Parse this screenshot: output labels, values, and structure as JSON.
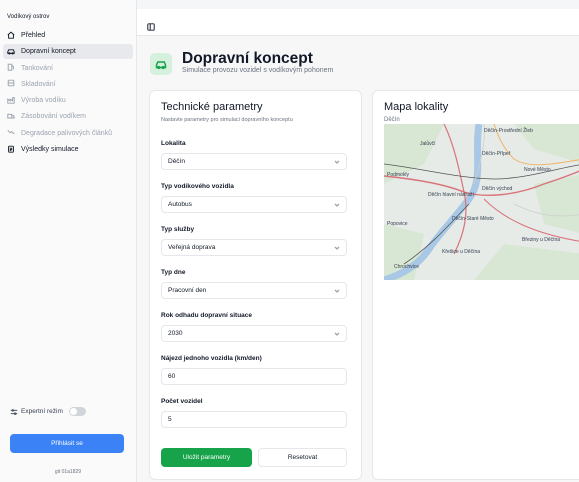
{
  "sidebar": {
    "title": "Vodíkový ostrov",
    "items": [
      {
        "label": "Přehled",
        "icon": "home-icon",
        "state": "normal"
      },
      {
        "label": "Dopravní koncept",
        "icon": "car-icon",
        "state": "active"
      },
      {
        "label": "Tankování",
        "icon": "fuel-pump-icon",
        "state": "disabled"
      },
      {
        "label": "Skladování",
        "icon": "database-icon",
        "state": "disabled"
      },
      {
        "label": "Výroba vodíku",
        "icon": "factory-icon",
        "state": "disabled"
      },
      {
        "label": "Zásobování vodíkem",
        "icon": "truck-icon",
        "state": "disabled"
      },
      {
        "label": "Degradace palivových článků",
        "icon": "trend-down-icon",
        "state": "disabled"
      },
      {
        "label": "Výsledky simulace",
        "icon": "clipboard-icon",
        "state": "normal"
      }
    ],
    "expert_mode_label": "Expertní režim",
    "login_label": "Přihlásit se",
    "git_label": "git 01a1829"
  },
  "header": {
    "title": "Dopravní koncept",
    "subtitle": "Simulace provozu vozidel s vodíkovým pohonem"
  },
  "params": {
    "title": "Technické parametry",
    "description": "Nastavte parametry pro simulaci dopravního konceptu",
    "fields": {
      "lokalita": {
        "label": "Lokalita",
        "value": "Děčín"
      },
      "vozidlo": {
        "label": "Typ vodíkového vozidla",
        "value": "Autobus"
      },
      "sluzba": {
        "label": "Typ služby",
        "value": "Veřejná doprava"
      },
      "den": {
        "label": "Typ dne",
        "value": "Pracovní den"
      },
      "rok": {
        "label": "Rok odhadu dopravní situace",
        "value": "2030"
      },
      "najezd": {
        "label": "Nájezd jednoho vozidla (km/den)",
        "value": "60"
      },
      "pocet": {
        "label": "Počet vozidel",
        "value": "5"
      }
    },
    "save_label": "Uložit parametry",
    "reset_label": "Resetovat"
  },
  "map": {
    "title": "Mapa lokality",
    "subtitle": "Děčín",
    "labels": {
      "prostredni_zleb": "Děčín-Prostřední Žleb",
      "jalovec": "Jalůvčí",
      "priper": "Děčín-Přípeř",
      "nove_mesto": "Nové Město",
      "podmokly": "Podmokly",
      "vychod": "Děčín východ",
      "hlavni_nadrazi": "Děčín hlavní nádraží",
      "popovice": "Popovice",
      "stare_mesto": "Děčín-Staré Město",
      "brezny": "Březiny u Děčína",
      "krezice": "Křešice u Děčína",
      "chrochvice": "Chrochvice"
    }
  },
  "colors": {
    "accent": "#16a34a",
    "primary_button": "#3b82f6"
  }
}
